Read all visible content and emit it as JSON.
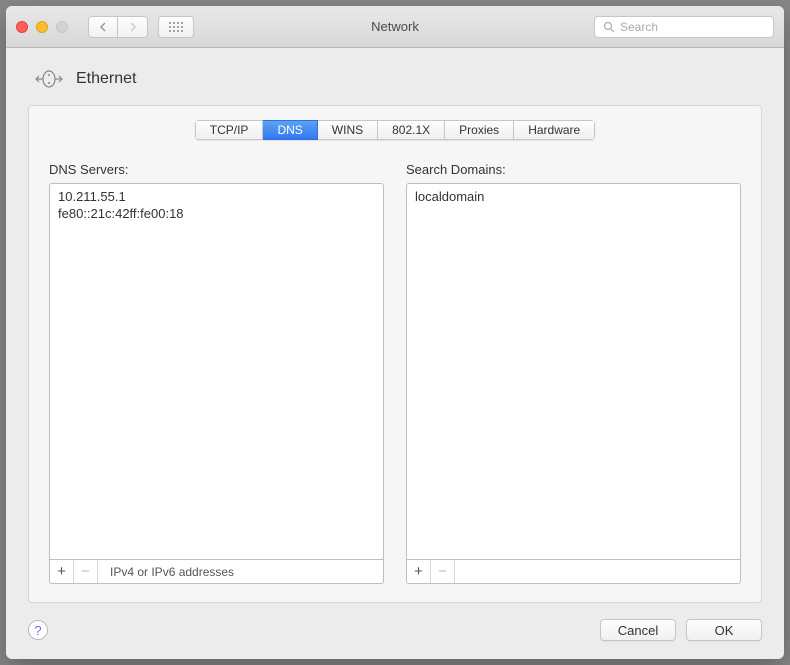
{
  "window": {
    "title": "Network",
    "search_placeholder": "Search"
  },
  "header": {
    "interface": "Ethernet"
  },
  "tabs": [
    {
      "label": "TCP/IP",
      "active": false
    },
    {
      "label": "DNS",
      "active": true
    },
    {
      "label": "WINS",
      "active": false
    },
    {
      "label": "802.1X",
      "active": false
    },
    {
      "label": "Proxies",
      "active": false
    },
    {
      "label": "Hardware",
      "active": false
    }
  ],
  "dns_servers": {
    "label": "DNS Servers:",
    "items": [
      "10.211.55.1",
      "fe80::21c:42ff:fe00:18"
    ],
    "hint": "IPv4 or IPv6 addresses"
  },
  "search_domains": {
    "label": "Search Domains:",
    "items": [
      "localdomain"
    ]
  },
  "buttons": {
    "add": "+",
    "remove": "−",
    "help": "?",
    "cancel": "Cancel",
    "ok": "OK"
  }
}
